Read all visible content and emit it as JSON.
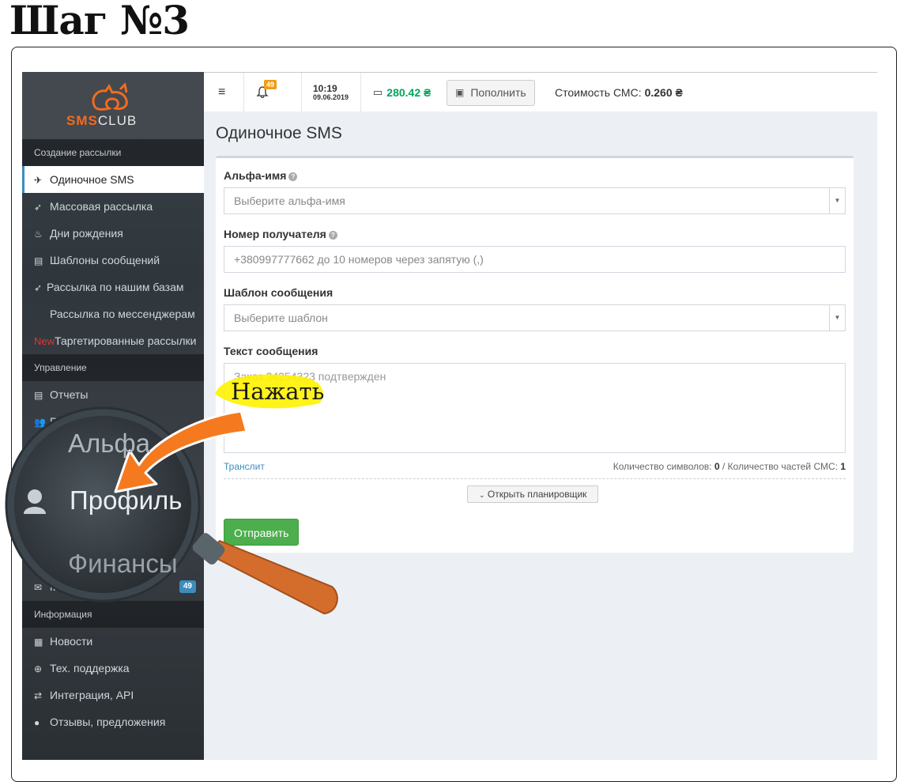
{
  "step_title": "Шаг №3",
  "brand": {
    "logo_main": "SMS",
    "logo_sub": "CLUB"
  },
  "sidebar": {
    "section_create": "Создание рассылки",
    "items_create": [
      {
        "label": "Одиночное SMS",
        "icon": "paper-plane-icon"
      },
      {
        "label": "Массовая рассылка",
        "icon": "rocket-icon"
      },
      {
        "label": "Дни рождения",
        "icon": "birthday-cake-icon"
      },
      {
        "label": "Шаблоны сообщений",
        "icon": "file-icon"
      },
      {
        "label": "Рассылка по нашим базам",
        "icon": "rocket-icon"
      },
      {
        "label": "Рассылка по мессенджерам",
        "icon": ""
      },
      {
        "label": "Таргетированные рассылки",
        "new": "New"
      }
    ],
    "section_manage": "Управление",
    "items_manage": [
      {
        "label": "Отчеты",
        "icon": "list-icon"
      },
      {
        "label": "Ба",
        "icon": "users-icon"
      }
    ],
    "messages_label": "Mo",
    "messages_badge": "49",
    "section_info": "Информация",
    "items_info": [
      {
        "label": "Новости",
        "icon": "newspaper-icon"
      },
      {
        "label": "Тех. поддержка",
        "icon": "lifebuoy-icon"
      },
      {
        "label": "Интеграция, API",
        "icon": "exchange-icon"
      },
      {
        "label": "Отзывы, предложения",
        "icon": "comment-icon"
      }
    ]
  },
  "topbar": {
    "notifications_count": "49",
    "time": "10:19",
    "date": "09.06.2019",
    "balance": "280.42 ₴",
    "topup_label": "Пополнить",
    "sms_cost_label": "Стоимость СМС:",
    "sms_cost_value": "0.260 ₴"
  },
  "main": {
    "page_title": "Одиночное SMS",
    "alpha_label": "Альфа-имя",
    "alpha_placeholder": "Выберите альфа-имя",
    "recipient_label": "Номер получателя",
    "recipient_placeholder": "+380997777662 до 10 номеров через запятую (,)",
    "template_label": "Шаблон сообщения",
    "template_placeholder": "Выберите шаблон",
    "text_label": "Текст сообщения",
    "text_placeholder": "Заказ 34254323 подтвержден",
    "translit": "Транслит",
    "chars_label": "Количество символов:",
    "chars_value": "0",
    "parts_label": "/ Количество частей СМС:",
    "parts_value": "1",
    "planner_button": "Открыть планировщик",
    "send_button": "Отправить"
  },
  "annotation": {
    "press_label": "Нажать",
    "magnifier_profile": "Профиль",
    "magnifier_alfa": "Альфа",
    "magnifier_finance": "Финансы",
    "accent": "#f26b21",
    "highlight": "#fff200"
  }
}
